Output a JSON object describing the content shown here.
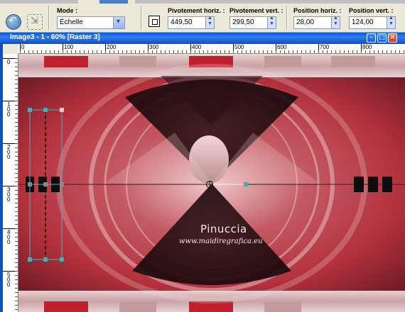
{
  "toolbar": {
    "mode_label": "Mode :",
    "mode_value": "Échelle",
    "pivot_x_label": "Pivotement horiz. :",
    "pivot_x_value": "449,50",
    "pivot_y_label": "Pivotement vert. :",
    "pivot_y_value": "299,50",
    "pos_x_label": "Position horiz. :",
    "pos_x_value": "28,00",
    "pos_y_label": "Position vert. :",
    "pos_y_value": "124,00"
  },
  "window": {
    "title": "Image3 - 1 - 60% [Raster 3]"
  },
  "ruler": {
    "top_labels": [
      "0",
      "100",
      "200",
      "300",
      "400",
      "500",
      "600",
      "700",
      "800"
    ],
    "left_labels": [
      "0",
      "100",
      "200",
      "300",
      "400",
      "500"
    ]
  },
  "watermark": {
    "name": "Pinuccia",
    "site": "www.maidiregrafica.eu"
  },
  "colors": {
    "accent_red": "#b3313d",
    "handle": "#2fb9b3",
    "titlebar": "#0a58d8"
  },
  "icons": {
    "undo": "undo-icon",
    "reset": "reset-icon",
    "position": "pick-position-icon"
  }
}
